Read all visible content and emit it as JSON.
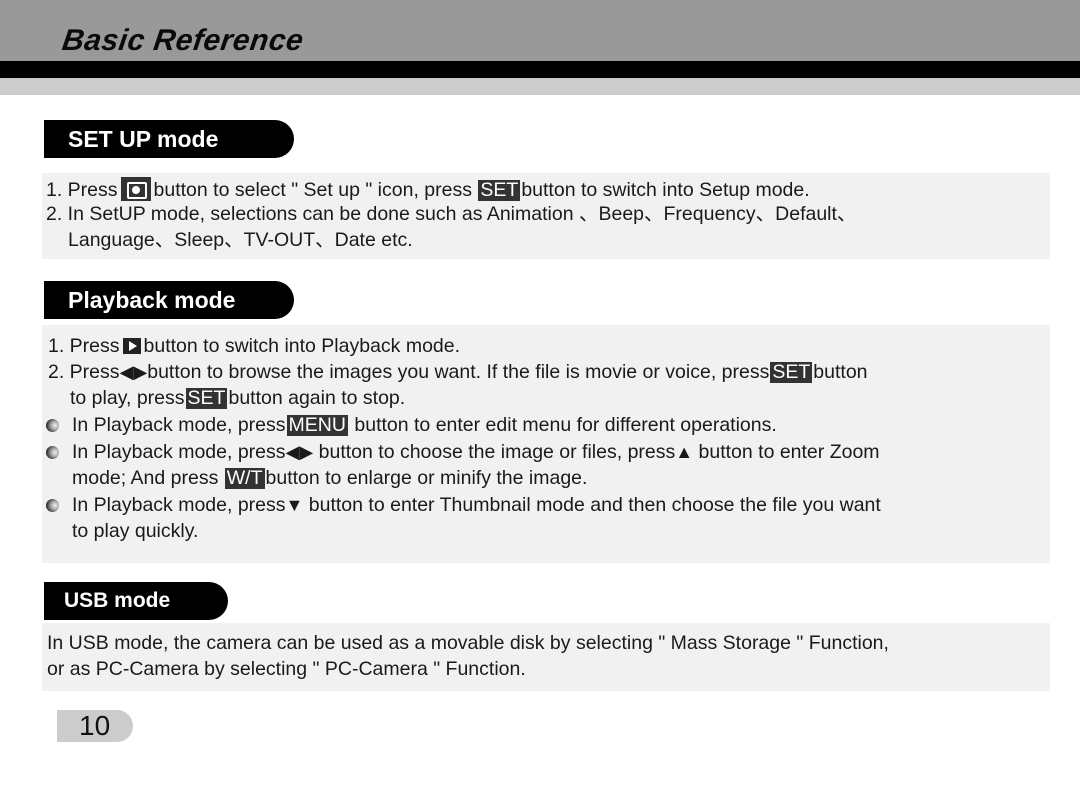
{
  "header": {
    "title": "Basic Reference"
  },
  "sections": {
    "setup": {
      "title": "SET UP mode",
      "line1": {
        "a": "1. Press",
        "b": "button to select  \" Set up \"  icon, press",
        "key": "SET",
        "c": "button to switch into Setup mode."
      },
      "line2": "2. In SetUP mode, selections can be done such as Animation 、Beep、Frequency、Default、",
      "line3": "Language、Sleep、TV-OUT、Date etc."
    },
    "playback": {
      "title": "Playback mode",
      "line1": {
        "a": "1. Press",
        "b": "button to switch into Playback mode."
      },
      "line2": {
        "a": "2. Press",
        "b": "button to browse the images you want. If the file is movie or voice, press",
        "key": "SET",
        "c": "button"
      },
      "line3": {
        "a": "to play, press",
        "key": "SET",
        "b": "button again to stop."
      },
      "bullet1": {
        "a": "In Playback mode, press",
        "key": "MENU",
        "b": "button to enter edit menu for different operations."
      },
      "bullet2": {
        "a": "In Playback mode, press",
        "b": "button to choose the image or files, press",
        "c": "button to enter Zoom"
      },
      "bullet2b": {
        "a": "mode; And press",
        "key": "W/T",
        "b": "button to enlarge or minify the image."
      },
      "bullet3": {
        "a": "In Playback mode, press",
        "b": "button to enter Thumbnail mode and then choose the file you want"
      },
      "bullet3b": "to play quickly."
    },
    "usb": {
      "title": "USB mode",
      "line1": "In USB mode, the camera can be used as a movable disk by selecting  \" Mass Storage \" Function,",
      "line2": "or as PC-Camera by selecting  \" PC-Camera \" Function."
    }
  },
  "icons": {
    "left": "◀",
    "right": "▶",
    "up": "▲",
    "down": "▼"
  },
  "page_number": "10"
}
